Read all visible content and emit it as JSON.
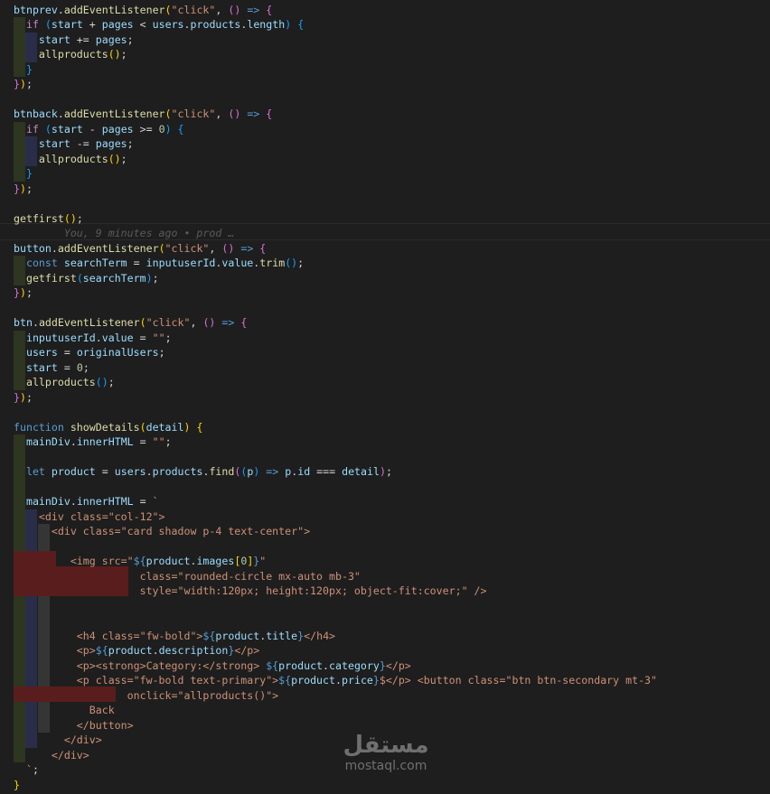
{
  "editor": {
    "lines": [
      {
        "tokens": [
          [
            "v",
            "btnprev"
          ],
          [
            "t",
            "."
          ],
          [
            "f",
            "addEventListener"
          ],
          [
            "p1",
            "("
          ],
          [
            "s",
            "\"click\""
          ],
          [
            "t",
            ", "
          ],
          [
            "p2",
            "()"
          ],
          [
            "k",
            " =>"
          ],
          [
            "t",
            " "
          ],
          [
            "p2",
            "{"
          ]
        ]
      },
      {
        "tokens": [
          [
            "t",
            "  "
          ],
          [
            "c",
            "if"
          ],
          [
            "t",
            " "
          ],
          [
            "p3",
            "("
          ],
          [
            "v",
            "start"
          ],
          [
            "t",
            " + "
          ],
          [
            "v",
            "pages"
          ],
          [
            "t",
            " < "
          ],
          [
            "v",
            "users"
          ],
          [
            "t",
            "."
          ],
          [
            "v",
            "products"
          ],
          [
            "t",
            "."
          ],
          [
            "v",
            "length"
          ],
          [
            "p3",
            ")"
          ],
          [
            "t",
            " "
          ],
          [
            "p3",
            "{"
          ]
        ]
      },
      {
        "tokens": [
          [
            "t",
            "    "
          ],
          [
            "v",
            "start"
          ],
          [
            "t",
            " += "
          ],
          [
            "v",
            "pages"
          ],
          [
            "t",
            ";"
          ]
        ]
      },
      {
        "tokens": [
          [
            "t",
            "    "
          ],
          [
            "f",
            "allproducts"
          ],
          [
            "p1",
            "()"
          ],
          [
            "t",
            ";"
          ]
        ]
      },
      {
        "tokens": [
          [
            "t",
            "  "
          ],
          [
            "p3",
            "}"
          ]
        ]
      },
      {
        "tokens": [
          [
            "p2",
            "}"
          ],
          [
            "p1",
            ")"
          ],
          [
            "t",
            ";"
          ]
        ]
      },
      {
        "tokens": []
      },
      {
        "tokens": [
          [
            "v",
            "btnback"
          ],
          [
            "t",
            "."
          ],
          [
            "f",
            "addEventListener"
          ],
          [
            "p1",
            "("
          ],
          [
            "s",
            "\"click\""
          ],
          [
            "t",
            ", "
          ],
          [
            "p2",
            "()"
          ],
          [
            "k",
            " =>"
          ],
          [
            "t",
            " "
          ],
          [
            "p2",
            "{"
          ]
        ]
      },
      {
        "tokens": [
          [
            "t",
            "  "
          ],
          [
            "c",
            "if"
          ],
          [
            "t",
            " "
          ],
          [
            "p3",
            "("
          ],
          [
            "v",
            "start"
          ],
          [
            "t",
            " - "
          ],
          [
            "v",
            "pages"
          ],
          [
            "t",
            " >= "
          ],
          [
            "n",
            "0"
          ],
          [
            "p3",
            ")"
          ],
          [
            "t",
            " "
          ],
          [
            "p3",
            "{"
          ]
        ]
      },
      {
        "tokens": [
          [
            "t",
            "    "
          ],
          [
            "v",
            "start"
          ],
          [
            "t",
            " -= "
          ],
          [
            "v",
            "pages"
          ],
          [
            "t",
            ";"
          ]
        ]
      },
      {
        "tokens": [
          [
            "t",
            "    "
          ],
          [
            "f",
            "allproducts"
          ],
          [
            "p1",
            "()"
          ],
          [
            "t",
            ";"
          ]
        ]
      },
      {
        "tokens": [
          [
            "t",
            "  "
          ],
          [
            "p3",
            "}"
          ]
        ]
      },
      {
        "tokens": [
          [
            "p2",
            "}"
          ],
          [
            "p1",
            ")"
          ],
          [
            "t",
            ";"
          ]
        ]
      },
      {
        "tokens": []
      },
      {
        "tokens": [
          [
            "f",
            "getfirst"
          ],
          [
            "p1",
            "()"
          ],
          [
            "t",
            ";"
          ]
        ]
      },
      {
        "tokens": [
          [
            "blame",
            "        You, 9 minutes ago • prod …"
          ]
        ]
      },
      {
        "tokens": [
          [
            "v",
            "button"
          ],
          [
            "t",
            "."
          ],
          [
            "f",
            "addEventListener"
          ],
          [
            "p1",
            "("
          ],
          [
            "s",
            "\"click\""
          ],
          [
            "t",
            ", "
          ],
          [
            "p2",
            "()"
          ],
          [
            "k",
            " =>"
          ],
          [
            "t",
            " "
          ],
          [
            "p2",
            "{"
          ]
        ]
      },
      {
        "tokens": [
          [
            "t",
            "  "
          ],
          [
            "k",
            "const"
          ],
          [
            "t",
            " "
          ],
          [
            "v",
            "searchTerm"
          ],
          [
            "t",
            " = "
          ],
          [
            "v",
            "inputuserId"
          ],
          [
            "t",
            "."
          ],
          [
            "v",
            "value"
          ],
          [
            "t",
            "."
          ],
          [
            "f",
            "trim"
          ],
          [
            "p3",
            "()"
          ],
          [
            "t",
            ";"
          ]
        ]
      },
      {
        "tokens": [
          [
            "t",
            "  "
          ],
          [
            "f",
            "getfirst"
          ],
          [
            "p3",
            "("
          ],
          [
            "v",
            "searchTerm"
          ],
          [
            "p3",
            ")"
          ],
          [
            "t",
            ";"
          ]
        ]
      },
      {
        "tokens": [
          [
            "p2",
            "}"
          ],
          [
            "p1",
            ")"
          ],
          [
            "t",
            ";"
          ]
        ]
      },
      {
        "tokens": []
      },
      {
        "tokens": [
          [
            "v",
            "btn"
          ],
          [
            "t",
            "."
          ],
          [
            "f",
            "addEventListener"
          ],
          [
            "p1",
            "("
          ],
          [
            "s",
            "\"click\""
          ],
          [
            "t",
            ", "
          ],
          [
            "p2",
            "()"
          ],
          [
            "k",
            " =>"
          ],
          [
            "t",
            " "
          ],
          [
            "p2",
            "{"
          ]
        ]
      },
      {
        "tokens": [
          [
            "t",
            "  "
          ],
          [
            "v",
            "inputuserId"
          ],
          [
            "t",
            "."
          ],
          [
            "v",
            "value"
          ],
          [
            "t",
            " = "
          ],
          [
            "s",
            "\"\""
          ],
          [
            "t",
            ";"
          ]
        ]
      },
      {
        "tokens": [
          [
            "t",
            "  "
          ],
          [
            "v",
            "users"
          ],
          [
            "t",
            " = "
          ],
          [
            "v",
            "originalUsers"
          ],
          [
            "t",
            ";"
          ]
        ]
      },
      {
        "tokens": [
          [
            "t",
            "  "
          ],
          [
            "v",
            "start"
          ],
          [
            "t",
            " = "
          ],
          [
            "n",
            "0"
          ],
          [
            "t",
            ";"
          ]
        ]
      },
      {
        "tokens": [
          [
            "t",
            "  "
          ],
          [
            "f",
            "allproducts"
          ],
          [
            "p3",
            "()"
          ],
          [
            "t",
            ";"
          ]
        ]
      },
      {
        "tokens": [
          [
            "p2",
            "}"
          ],
          [
            "p1",
            ")"
          ],
          [
            "t",
            ";"
          ]
        ]
      },
      {
        "tokens": []
      },
      {
        "tokens": [
          [
            "k",
            "function"
          ],
          [
            "t",
            " "
          ],
          [
            "f",
            "showDetails"
          ],
          [
            "p1",
            "("
          ],
          [
            "v",
            "detail"
          ],
          [
            "p1",
            ")"
          ],
          [
            "t",
            " "
          ],
          [
            "p1",
            "{"
          ]
        ]
      },
      {
        "tokens": [
          [
            "t",
            "  "
          ],
          [
            "v",
            "mainDiv"
          ],
          [
            "t",
            "."
          ],
          [
            "v",
            "innerHTML"
          ],
          [
            "t",
            " = "
          ],
          [
            "s",
            "\"\""
          ],
          [
            "t",
            ";"
          ]
        ]
      },
      {
        "tokens": []
      },
      {
        "tokens": [
          [
            "t",
            "  "
          ],
          [
            "k",
            "let"
          ],
          [
            "t",
            " "
          ],
          [
            "v",
            "product"
          ],
          [
            "t",
            " = "
          ],
          [
            "v",
            "users"
          ],
          [
            "t",
            "."
          ],
          [
            "v",
            "products"
          ],
          [
            "t",
            "."
          ],
          [
            "f",
            "find"
          ],
          [
            "p2",
            "("
          ],
          [
            "p3",
            "("
          ],
          [
            "v",
            "p"
          ],
          [
            "p3",
            ")"
          ],
          [
            "k",
            " =>"
          ],
          [
            "t",
            " "
          ],
          [
            "v",
            "p"
          ],
          [
            "t",
            "."
          ],
          [
            "v",
            "id"
          ],
          [
            "t",
            " === "
          ],
          [
            "v",
            "detail"
          ],
          [
            "p2",
            ")"
          ],
          [
            "t",
            ";"
          ]
        ]
      },
      {
        "tokens": []
      },
      {
        "tokens": [
          [
            "t",
            "  "
          ],
          [
            "v",
            "mainDiv"
          ],
          [
            "t",
            "."
          ],
          [
            "v",
            "innerHTML"
          ],
          [
            "t",
            " = "
          ],
          [
            "s",
            "`"
          ]
        ]
      },
      {
        "tokens": [
          [
            "s",
            "    <div class=\"col-12\">"
          ]
        ]
      },
      {
        "tokens": [
          [
            "s",
            "      <div class=\"card shadow p-4 text-center\">"
          ]
        ]
      },
      {
        "tokens": []
      },
      {
        "tokens": [
          [
            "s",
            "         <img src=\""
          ],
          [
            "k",
            "${"
          ],
          [
            "v",
            "product"
          ],
          [
            "t",
            "."
          ],
          [
            "v",
            "images"
          ],
          [
            "p1",
            "["
          ],
          [
            "n",
            "0"
          ],
          [
            "p1",
            "]"
          ],
          [
            "k",
            "}"
          ],
          [
            "s",
            "\""
          ]
        ]
      },
      {
        "tokens": [
          [
            "s",
            "                    class=\"rounded-circle mx-auto mb-3\""
          ]
        ]
      },
      {
        "tokens": [
          [
            "s",
            "                    style=\"width:120px; height:120px; object-fit:cover;\" />"
          ]
        ]
      },
      {
        "tokens": []
      },
      {
        "tokens": []
      },
      {
        "tokens": [
          [
            "s",
            "          <h4 class=\"fw-bold\">"
          ],
          [
            "k",
            "${"
          ],
          [
            "v",
            "product"
          ],
          [
            "t",
            "."
          ],
          [
            "v",
            "title"
          ],
          [
            "k",
            "}"
          ],
          [
            "s",
            "</h4>"
          ]
        ]
      },
      {
        "tokens": [
          [
            "s",
            "          <p>"
          ],
          [
            "k",
            "${"
          ],
          [
            "v",
            "product"
          ],
          [
            "t",
            "."
          ],
          [
            "v",
            "description"
          ],
          [
            "k",
            "}"
          ],
          [
            "s",
            "</p>"
          ]
        ]
      },
      {
        "tokens": [
          [
            "s",
            "          <p><strong>Category:</strong> "
          ],
          [
            "k",
            "${"
          ],
          [
            "v",
            "product"
          ],
          [
            "t",
            "."
          ],
          [
            "v",
            "category"
          ],
          [
            "k",
            "}"
          ],
          [
            "s",
            "</p>"
          ]
        ]
      },
      {
        "tokens": [
          [
            "s",
            "          <p class=\"fw-bold text-primary\">"
          ],
          [
            "k",
            "${"
          ],
          [
            "v",
            "product"
          ],
          [
            "t",
            "."
          ],
          [
            "v",
            "price"
          ],
          [
            "k",
            "}"
          ],
          [
            "s",
            "$</p> <button class=\"btn btn-secondary mt-3\""
          ]
        ]
      },
      {
        "tokens": [
          [
            "s",
            "                  onclick=\"allproducts()\">"
          ]
        ]
      },
      {
        "tokens": [
          [
            "s",
            "            Back"
          ]
        ]
      },
      {
        "tokens": [
          [
            "s",
            "          </button>"
          ]
        ]
      },
      {
        "tokens": [
          [
            "s",
            "        </div>"
          ]
        ]
      },
      {
        "tokens": [
          [
            "s",
            "      </div>"
          ]
        ]
      },
      {
        "tokens": [
          [
            "s",
            "  `"
          ],
          [
            "t",
            ";"
          ]
        ]
      },
      {
        "tokens": [
          [
            "p1",
            "}"
          ]
        ]
      }
    ]
  },
  "watermark": {
    "logo": "مستقل",
    "text": "mostaql.com"
  }
}
